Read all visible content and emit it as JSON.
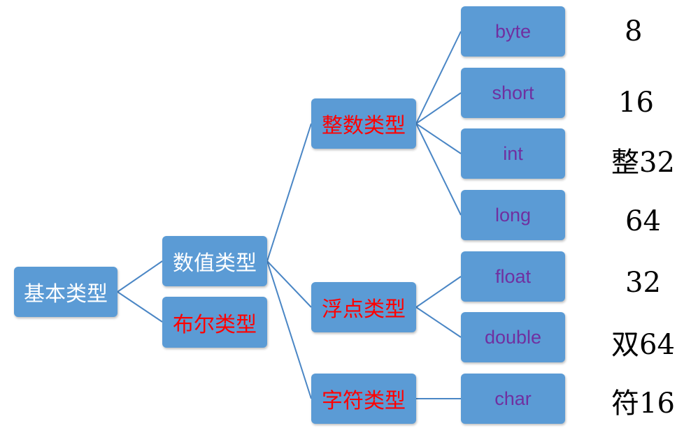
{
  "root": {
    "label": "基本类型"
  },
  "level1": [
    {
      "label": "数值类型"
    },
    {
      "label": "布尔类型"
    }
  ],
  "level2": [
    {
      "label": "整数类型"
    },
    {
      "label": "浮点类型"
    },
    {
      "label": "字符类型"
    }
  ],
  "leaves": [
    {
      "label": "byte",
      "bits": "8"
    },
    {
      "label": "short",
      "bits": "16"
    },
    {
      "label": "int",
      "bits": "整32"
    },
    {
      "label": "long",
      "bits": "64"
    },
    {
      "label": "float",
      "bits": "32"
    },
    {
      "label": "double",
      "bits": "双64"
    },
    {
      "label": "char",
      "bits": "符16"
    }
  ],
  "colors": {
    "node_fill": "#5b9bd5",
    "connector": "#4a86c5",
    "text_white": "#ffffff",
    "text_red": "#ff0000",
    "text_purple": "#7030a0"
  }
}
